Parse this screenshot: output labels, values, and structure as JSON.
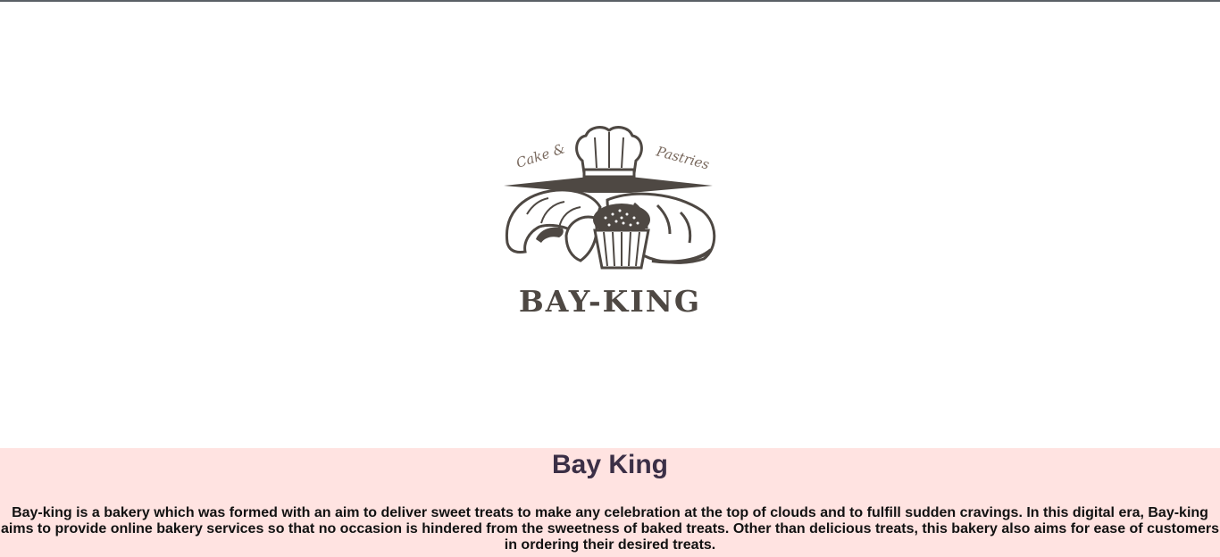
{
  "logo": {
    "tagline_left": "Cake &",
    "tagline_right": "Pastries",
    "wordmark": "BAY-KING",
    "icon": "bakery-logo"
  },
  "about": {
    "title": "Bay King",
    "description": "Bay-king is a bakery which was formed with an aim to deliver sweet treats to make any celebration at the top of clouds and to fulfill sudden cravings. In this digital era, Bay-king aims to provide online bakery services so that no occasion is hindered from the sweetness of baked treats. Other than delicious treats, this bakery also aims for ease of customers in ordering their desired treats."
  },
  "colors": {
    "logo_ink": "#4e4843",
    "about_background": "#ffe3e1",
    "title_color": "#3b2f46"
  }
}
